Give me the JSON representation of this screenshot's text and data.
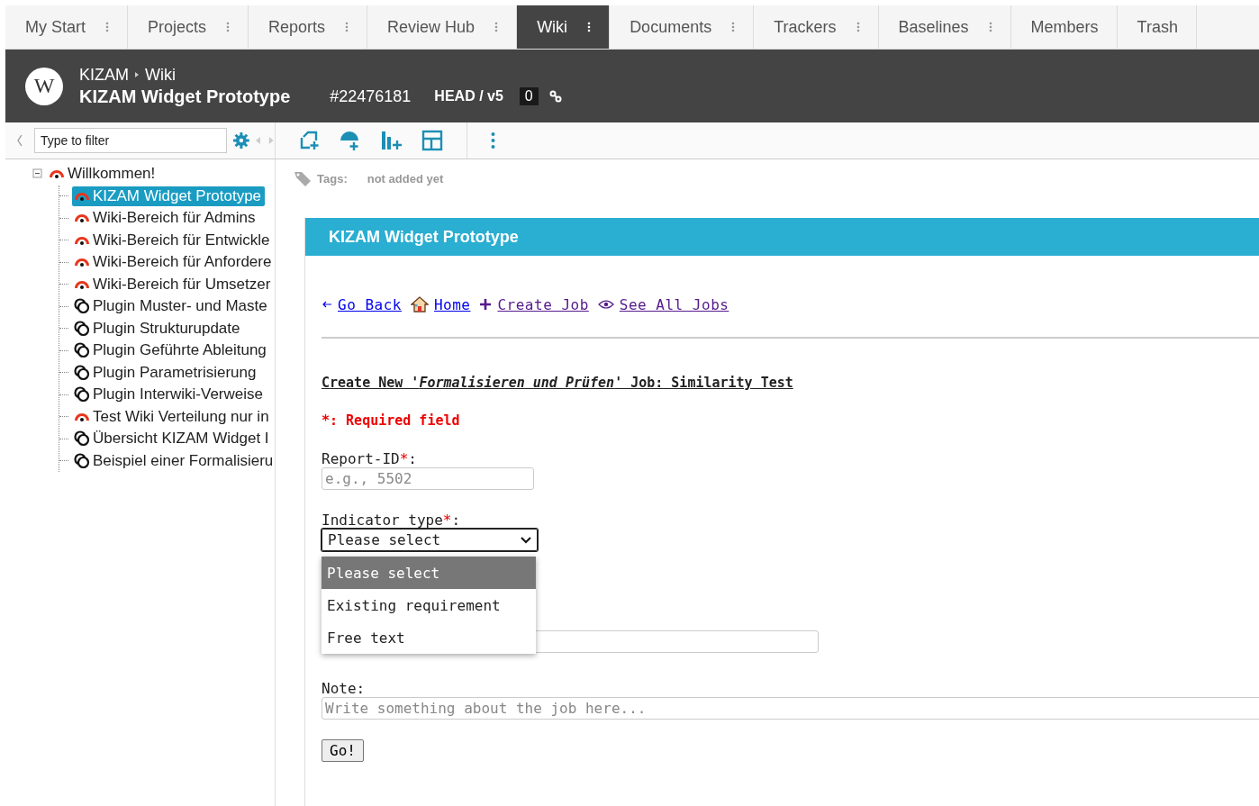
{
  "tabs": [
    {
      "label": "My Start",
      "selected": false,
      "menu": true
    },
    {
      "label": "Projects",
      "selected": false,
      "menu": true
    },
    {
      "label": "Reports",
      "selected": false,
      "menu": true
    },
    {
      "label": "Review Hub",
      "selected": false,
      "menu": true
    },
    {
      "label": "Wiki",
      "selected": true,
      "menu": true
    },
    {
      "label": "Documents",
      "selected": false,
      "menu": true
    },
    {
      "label": "Trackers",
      "selected": false,
      "menu": true
    },
    {
      "label": "Baselines",
      "selected": false,
      "menu": true
    },
    {
      "label": "Members",
      "selected": false,
      "menu": false
    },
    {
      "label": "Trash",
      "selected": false,
      "menu": false
    }
  ],
  "header": {
    "logo": "W",
    "breadcrumb": [
      "KIZAM",
      "Wiki"
    ],
    "title": "KIZAM Widget Prototype",
    "id": "#22476181",
    "version": "HEAD / v5",
    "count": "0"
  },
  "sidebar": {
    "filter": {
      "placeholder": "Type to filter"
    },
    "tree": [
      {
        "label": "Willkommen!",
        "kind": "wiki",
        "selected": false,
        "expanded": true,
        "children": [
          {
            "label": "KIZAM Widget Prototype",
            "kind": "wiki",
            "selected": true
          },
          {
            "label": "Wiki-Bereich für Admins",
            "kind": "wiki",
            "selected": false
          },
          {
            "label": "Wiki-Bereich für Entwickle",
            "kind": "wiki",
            "selected": false
          },
          {
            "label": "Wiki-Bereich für Anfordere",
            "kind": "wiki",
            "selected": false
          },
          {
            "label": "Wiki-Bereich für Umsetzer",
            "kind": "wiki",
            "selected": false
          },
          {
            "label": "Plugin Muster- und Maste",
            "kind": "plugin",
            "selected": false
          },
          {
            "label": "Plugin Strukturupdate",
            "kind": "plugin",
            "selected": false
          },
          {
            "label": "Plugin Geführte Ableitung",
            "kind": "plugin",
            "selected": false
          },
          {
            "label": "Plugin Parametrisierung",
            "kind": "plugin",
            "selected": false
          },
          {
            "label": "Plugin Interwiki-Verweise",
            "kind": "plugin",
            "selected": false
          },
          {
            "label": "Test Wiki Verteilung nur in",
            "kind": "wiki",
            "selected": false
          },
          {
            "label": "Übersicht KIZAM Widget I",
            "kind": "plugin",
            "selected": false
          },
          {
            "label": "Beispiel einer Formalisieru",
            "kind": "plugin",
            "selected": false
          }
        ]
      }
    ]
  },
  "tags": {
    "label": "Tags:",
    "value": "not added yet"
  },
  "panel": {
    "title": "KIZAM Widget Prototype",
    "links": [
      {
        "label": "Go Back",
        "kind": "back",
        "visited": false
      },
      {
        "label": "Home",
        "kind": "home",
        "visited": false
      },
      {
        "label": "Create Job",
        "kind": "plus",
        "visited": true
      },
      {
        "label": "See All Jobs",
        "kind": "eye",
        "visited": true
      }
    ],
    "heading": "Create New '*Formalisieren und Prüfen*' Job: Similarity Test",
    "required_note": {
      "mark": "*",
      "text": ": Required field"
    },
    "report_id": {
      "label": "Report-ID",
      "required_mark": "*",
      "label_end": ":",
      "placeholder": "e.g., 5502"
    },
    "indicator": {
      "label": "Indicator type",
      "required_mark": "*",
      "label_end": ":",
      "value": "Please select",
      "expanded": true,
      "options": [
        {
          "label": "Please select",
          "selected": true
        },
        {
          "label": "Existing requirement",
          "selected": false
        },
        {
          "label": "Free text",
          "selected": false
        }
      ]
    },
    "note": {
      "label": "Note:",
      "placeholder": "Write something about the job here..."
    },
    "submit": "Go!"
  }
}
